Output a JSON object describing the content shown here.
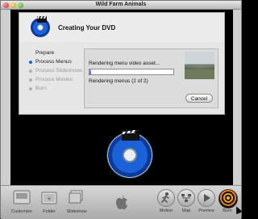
{
  "window": {
    "title": "Wild Farm Animals"
  },
  "dialog": {
    "title": "Creating Your DVD",
    "steps": [
      {
        "label": "Prepare",
        "state": "done"
      },
      {
        "label": "Process Menus",
        "state": "active"
      },
      {
        "label": "Process Slideshows",
        "state": "pending"
      },
      {
        "label": "Process Movies",
        "state": "pending"
      },
      {
        "label": "Burn",
        "state": "pending"
      }
    ],
    "status_text": "Rendering menu video asset...",
    "progress_value": 0.02,
    "sub_status": "Rendering menus (2 of 2)",
    "cancel_label": "Cancel"
  },
  "toolbar": {
    "customize_label": "Customize",
    "folder_label": "Folder",
    "slideshow_label": "Slideshow",
    "motion_label": "Motion",
    "map_label": "Map",
    "preview_label": "Preview",
    "burn_label": "Burn"
  },
  "colors": {
    "accent": "#1b63de",
    "progress": "#2463d8"
  }
}
